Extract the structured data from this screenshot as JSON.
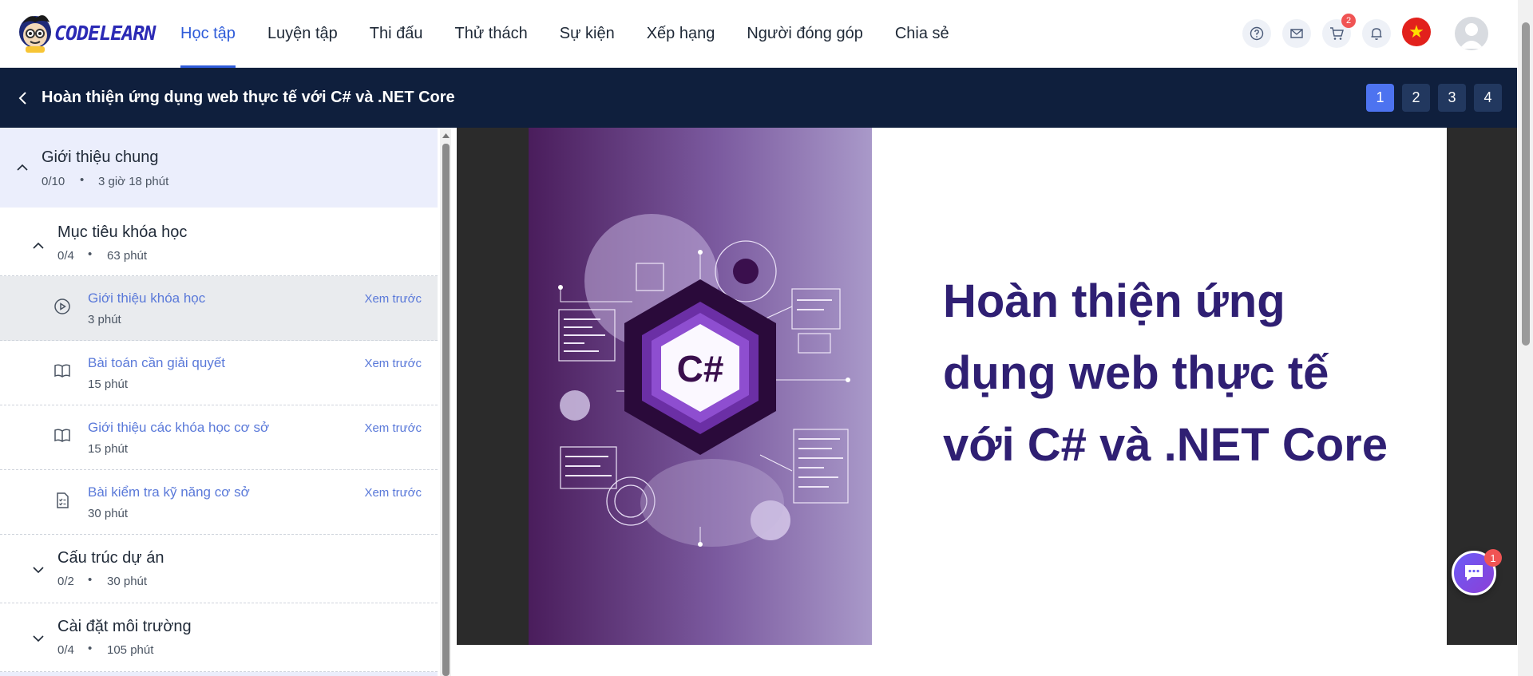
{
  "header": {
    "logo_text": "CODELEARN",
    "nav": [
      "Học tập",
      "Luyện tập",
      "Thi đấu",
      "Thử thách",
      "Sự kiện",
      "Xếp hạng",
      "Người đóng góp",
      "Chia sẻ"
    ],
    "active_nav_index": 0,
    "cart_badge": "2",
    "icons": [
      "help-icon",
      "mail-icon",
      "cart-icon",
      "bell-icon",
      "vietnam-flag-icon",
      "avatar"
    ]
  },
  "course": {
    "title": "Hoàn thiện ứng dụng web thực tế với C# và .NET Core",
    "pages": [
      "1",
      "2",
      "3",
      "4"
    ],
    "active_page": "1"
  },
  "sidebar": {
    "section": {
      "title": "Giới thiệu chung",
      "progress": "0/10",
      "duration": "3 giờ 18 phút"
    },
    "subsections": [
      {
        "title": "Mục tiêu khóa học",
        "progress": "0/4",
        "duration": "63 phút",
        "expanded": true
      },
      {
        "title": "Cấu trúc dự án",
        "progress": "0/2",
        "duration": "30 phút",
        "expanded": false
      },
      {
        "title": "Cài đặt môi trường",
        "progress": "0/4",
        "duration": "105 phút",
        "expanded": false
      }
    ],
    "lessons": [
      {
        "title": "Giới thiệu khóa học",
        "duration": "3 phút",
        "preview": "Xem trước",
        "icon": "play-circle-icon"
      },
      {
        "title": "Bài toán cần giải quyết",
        "duration": "15 phút",
        "preview": "Xem trước",
        "icon": "book-icon"
      },
      {
        "title": "Giới thiệu các khóa học cơ sở",
        "duration": "15 phút",
        "preview": "Xem trước",
        "icon": "book-icon"
      },
      {
        "title": "Bài kiểm tra kỹ năng cơ sở",
        "duration": "30 phút",
        "preview": "Xem trước",
        "icon": "checklist-icon"
      }
    ]
  },
  "slide": {
    "title_line1": "Hoàn thiện ứng",
    "title_line2": "dụng web thực tế",
    "title_line3": "với C# và .NET Core",
    "logo_text": "C#"
  },
  "chat": {
    "badge": "1"
  },
  "colors": {
    "accent": "#2e5bd9",
    "header_dark": "#0f1f3d",
    "slide_text": "#2f1f73",
    "badge": "#f05454"
  }
}
